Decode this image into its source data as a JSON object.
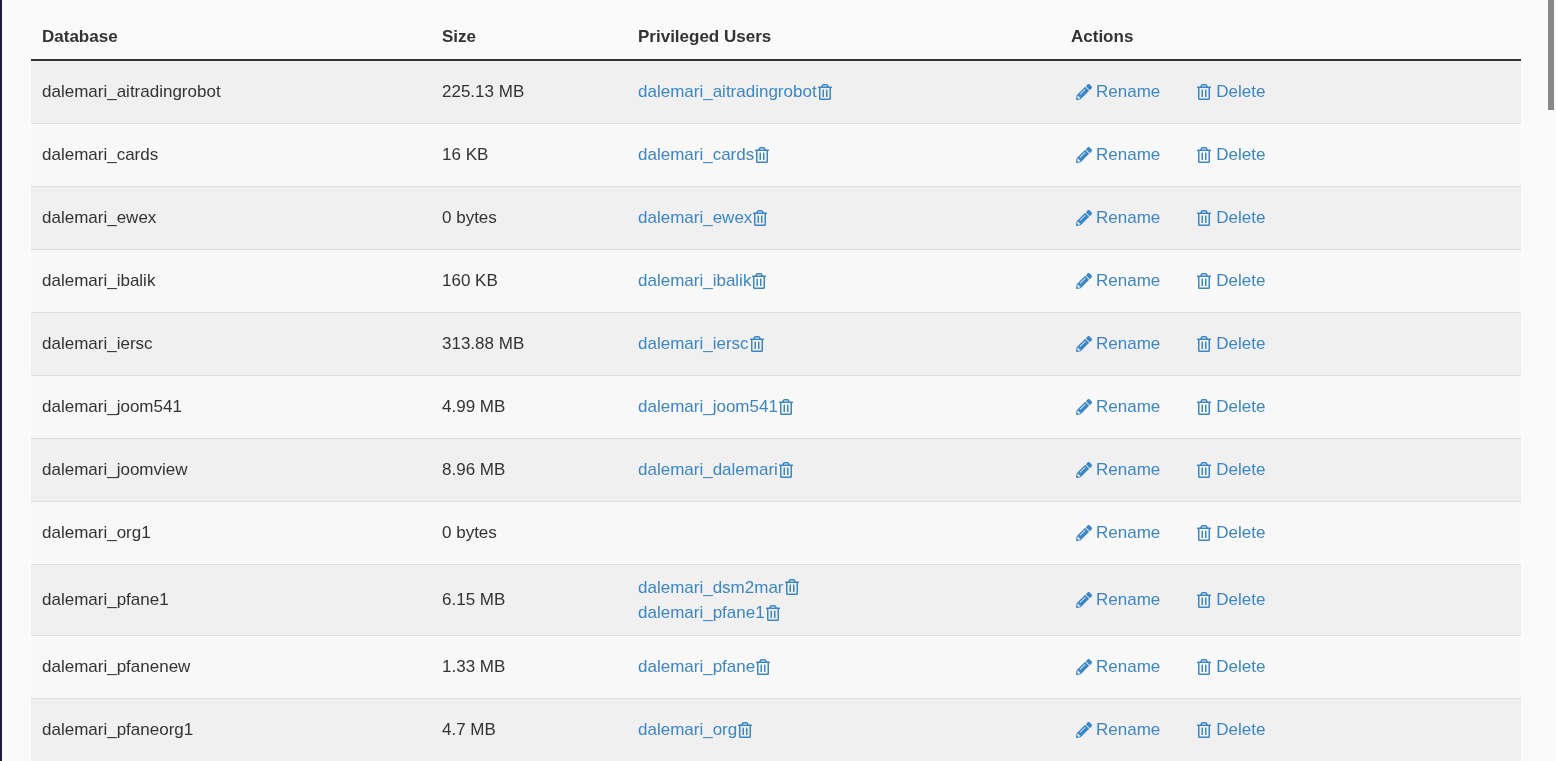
{
  "table": {
    "columns": [
      "Database",
      "Size",
      "Privileged Users",
      "Actions"
    ],
    "rows": [
      {
        "database": "dalemari_aitradingrobot",
        "size": "225.13 MB",
        "users": [
          "dalemari_aitradingrobot"
        ],
        "actions": [
          "Rename",
          "Delete"
        ]
      },
      {
        "database": "dalemari_cards",
        "size": "16 KB",
        "users": [
          "dalemari_cards"
        ],
        "actions": [
          "Rename",
          "Delete"
        ]
      },
      {
        "database": "dalemari_ewex",
        "size": "0 bytes",
        "users": [
          "dalemari_ewex"
        ],
        "actions": [
          "Rename",
          "Delete"
        ]
      },
      {
        "database": "dalemari_ibalik",
        "size": "160 KB",
        "users": [
          "dalemari_ibalik"
        ],
        "actions": [
          "Rename",
          "Delete"
        ]
      },
      {
        "database": "dalemari_iersc",
        "size": "313.88 MB",
        "users": [
          "dalemari_iersc"
        ],
        "actions": [
          "Rename",
          "Delete"
        ]
      },
      {
        "database": "dalemari_joom541",
        "size": "4.99 MB",
        "users": [
          "dalemari_joom541"
        ],
        "actions": [
          "Rename",
          "Delete"
        ]
      },
      {
        "database": "dalemari_joomview",
        "size": "8.96 MB",
        "users": [
          "dalemari_dalemari"
        ],
        "actions": [
          "Rename",
          "Delete"
        ]
      },
      {
        "database": "dalemari_org1",
        "size": "0 bytes",
        "users": [],
        "actions": [
          "Rename",
          "Delete"
        ]
      },
      {
        "database": "dalemari_pfane1",
        "size": "6.15 MB",
        "users": [
          "dalemari_dsm2mar",
          "dalemari_pfane1"
        ],
        "actions": [
          "Rename",
          "Delete"
        ]
      },
      {
        "database": "dalemari_pfanenew",
        "size": "1.33 MB",
        "users": [
          "dalemari_pfane"
        ],
        "actions": [
          "Rename",
          "Delete"
        ]
      },
      {
        "database": "dalemari_pfaneorg1",
        "size": "4.7 MB",
        "users": [
          "dalemari_org"
        ],
        "actions": [
          "Rename",
          "Delete"
        ]
      }
    ]
  }
}
